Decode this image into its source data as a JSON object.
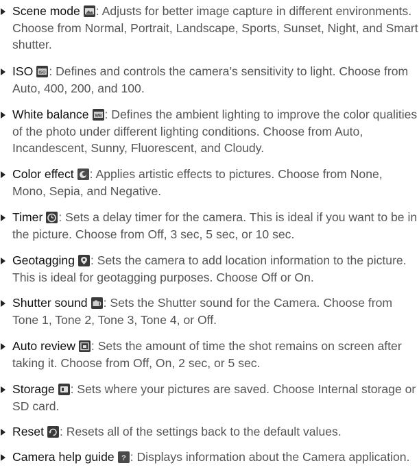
{
  "items": [
    {
      "term": "Scene mode",
      "icon": "scene-mode-icon",
      "desc": ": Adjusts for better image capture in different environments. Choose from Normal, Portrait, Landscape, Sports, Sunset, Night, and Smart shutter."
    },
    {
      "term": "ISO",
      "icon": "iso-icon",
      "desc": ": Defines and controls the camera’s sensitivity to light. Choose from Auto, 400, 200, and 100."
    },
    {
      "term": "White balance",
      "icon": "white-balance-icon",
      "desc": ": Defines the ambient lighting to improve the color qualities of the photo under different lighting conditions. Choose from Auto, Incandescent, Sunny, Fluorescent, and Cloudy."
    },
    {
      "term": "Color effect",
      "icon": "color-effect-icon",
      "desc": ": Applies artistic effects to pictures. Choose from None, Mono, Sepia, and Negative."
    },
    {
      "term": "Timer",
      "icon": "timer-icon",
      "desc": ": Sets a delay timer for the camera. This is ideal if you want to be in the picture. Choose from Off, 3 sec, 5 sec, or 10 sec."
    },
    {
      "term": "Geotagging",
      "icon": "geotagging-icon",
      "desc": ": Sets the camera to add location information to the picture. This is ideal for geotagging purposes. Choose Off or On."
    },
    {
      "term": "Shutter sound",
      "icon": "shutter-sound-icon",
      "desc": ": Sets the Shutter sound for the Camera. Choose from Tone 1, Tone 2, Tone 3, Tone 4, or Off."
    },
    {
      "term": "Auto review",
      "icon": "auto-review-icon",
      "desc": ": Sets the amount of time the shot remains on screen after taking it. Choose from Off, On, 2 sec, or  5 sec."
    },
    {
      "term": "Storage",
      "icon": "storage-icon",
      "desc": ": Sets where your pictures are saved. Choose Internal storage or SD card."
    },
    {
      "term": "Reset",
      "icon": "reset-icon",
      "desc": ": Resets all of the settings back to the default values."
    },
    {
      "term": "Camera help guide",
      "icon": "camera-help-guide-icon",
      "desc": ": Displays information about the Camera application."
    }
  ]
}
